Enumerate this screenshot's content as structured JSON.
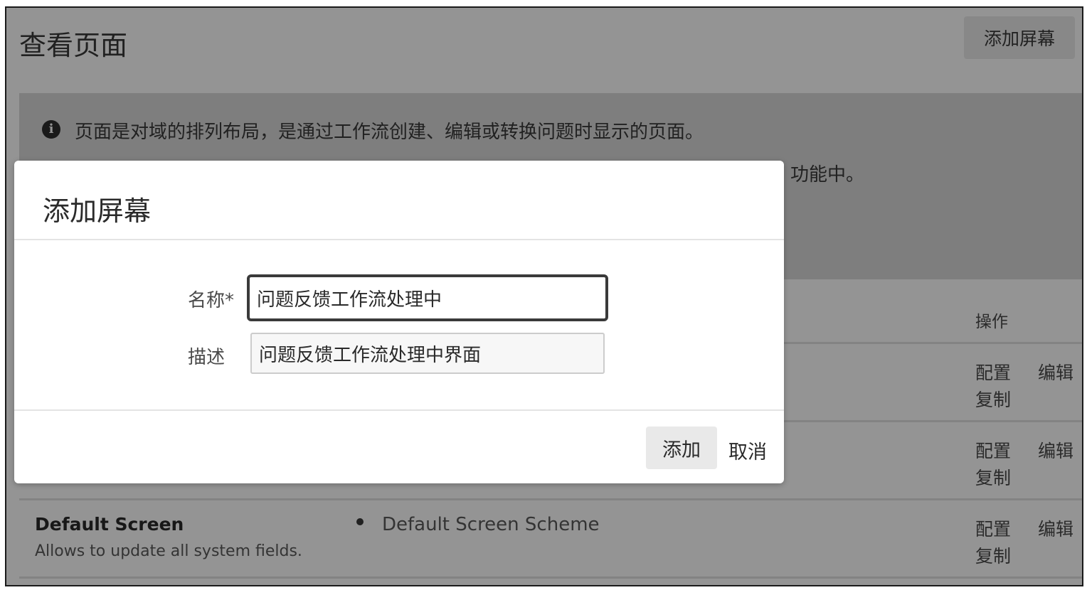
{
  "page": {
    "title": "查看页面",
    "add_screen_button": "添加屏幕"
  },
  "info": {
    "line1": "页面是对域的排列布局，是通过工作流创建、编辑或转换问题时显示的页面。",
    "line2_visible_fragment": "功能中。"
  },
  "table": {
    "actions_header": "操作",
    "rows": [
      {
        "configure": "配置",
        "edit": "编辑",
        "copy": "复制"
      },
      {
        "configure": "配置",
        "edit": "编辑",
        "copy": "复制"
      },
      {
        "name": "Default Screen",
        "description": "Allows to update all system fields.",
        "scheme": "Default Screen Scheme",
        "configure": "配置",
        "edit": "编辑",
        "copy": "复制"
      }
    ]
  },
  "dialog": {
    "title": "添加屏幕",
    "name_label": "名称*",
    "name_value": "问题反馈工作流处理中",
    "desc_label": "描述",
    "desc_value": "问题反馈工作流处理中界面",
    "submit_label": "添加",
    "cancel_label": "取消"
  }
}
